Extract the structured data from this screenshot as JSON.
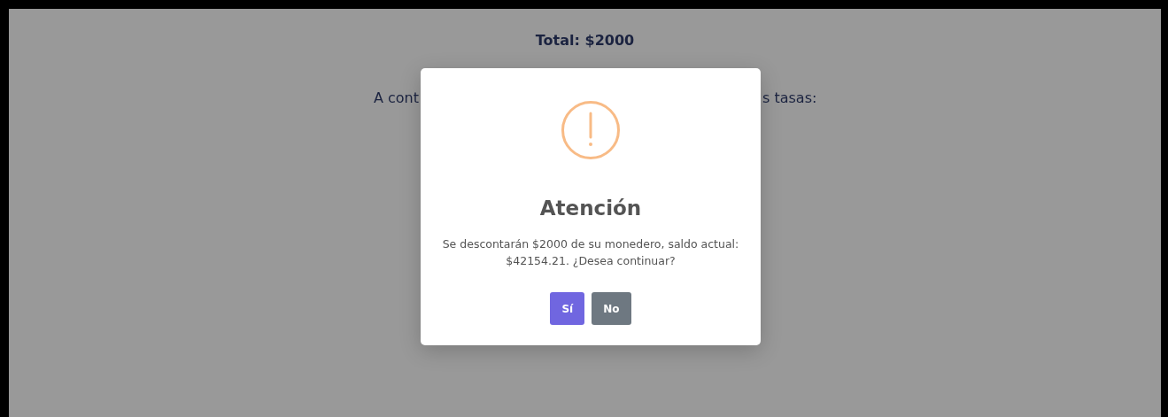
{
  "page": {
    "total": "Total: $2000",
    "intro_left": "A cont",
    "intro_right": "s tasas:"
  },
  "dialog": {
    "title": "Atención",
    "message": "Se descontarán $2000 de su monedero, saldo actual: $42154.21. ¿Desea continuar?",
    "buttons": [
      {
        "label": "Sí",
        "kind": "confirm"
      },
      {
        "label": "No",
        "kind": "cancel"
      }
    ]
  }
}
